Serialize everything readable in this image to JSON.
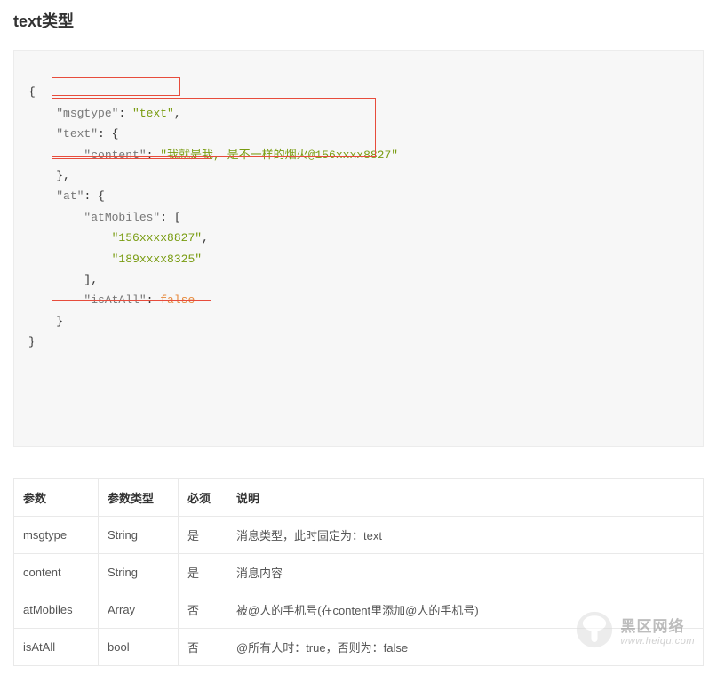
{
  "title": "text类型",
  "code": {
    "l0": "{",
    "l1_key": "\"msgtype\"",
    "l1_val": "\"text\"",
    "l2_key": "\"text\"",
    "l3_key": "\"content\"",
    "l3_val": "\"我就是我, 是不一样的烟火@156xxxx8827\"",
    "l4": "},",
    "l5_key": "\"at\"",
    "l6_key": "\"atMobiles\"",
    "l7_val": "\"156xxxx8827\"",
    "l8_val": "\"189xxxx8325\"",
    "l9": "],",
    "l10_key": "\"isAtAll\"",
    "l10_val": "false",
    "l11": "}",
    "l12": "}"
  },
  "table": {
    "headers": {
      "param": "参数",
      "type": "参数类型",
      "required": "必须",
      "desc": "说明"
    },
    "rows": [
      {
        "param": "msgtype",
        "type": "String",
        "required": "是",
        "desc": "消息类型，此时固定为：text"
      },
      {
        "param": "content",
        "type": "String",
        "required": "是",
        "desc": "消息内容"
      },
      {
        "param": "atMobiles",
        "type": "Array",
        "required": "否",
        "desc": "被@人的手机号(在content里添加@人的手机号)"
      },
      {
        "param": "isAtAll",
        "type": "bool",
        "required": "否",
        "desc": "@所有人时：true，否则为：false"
      }
    ]
  },
  "watermark": {
    "title": "黑区网络",
    "url": "www.heiqu.com"
  }
}
